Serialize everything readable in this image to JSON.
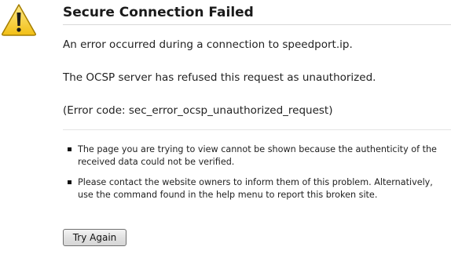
{
  "error": {
    "title": "Secure Connection Failed",
    "message": "An error occurred during a connection to speedport.ip.",
    "detail": "The OCSP server has refused this request as unauthorized.",
    "error_code": "(Error code: sec_error_ocsp_unauthorized_request)"
  },
  "notes": [
    "The page you are trying to view cannot be shown because the authenticity of the received data could not be verified.",
    "Please contact the website owners to inform them of this problem. Alternatively, use the command found in the help menu to report this broken site."
  ],
  "actions": {
    "try_again_label": "Try Again"
  },
  "icons": {
    "warning": "warning-triangle-icon"
  },
  "colors": {
    "warning_fill": "#f5c518",
    "warning_outline": "#8a6d00"
  }
}
